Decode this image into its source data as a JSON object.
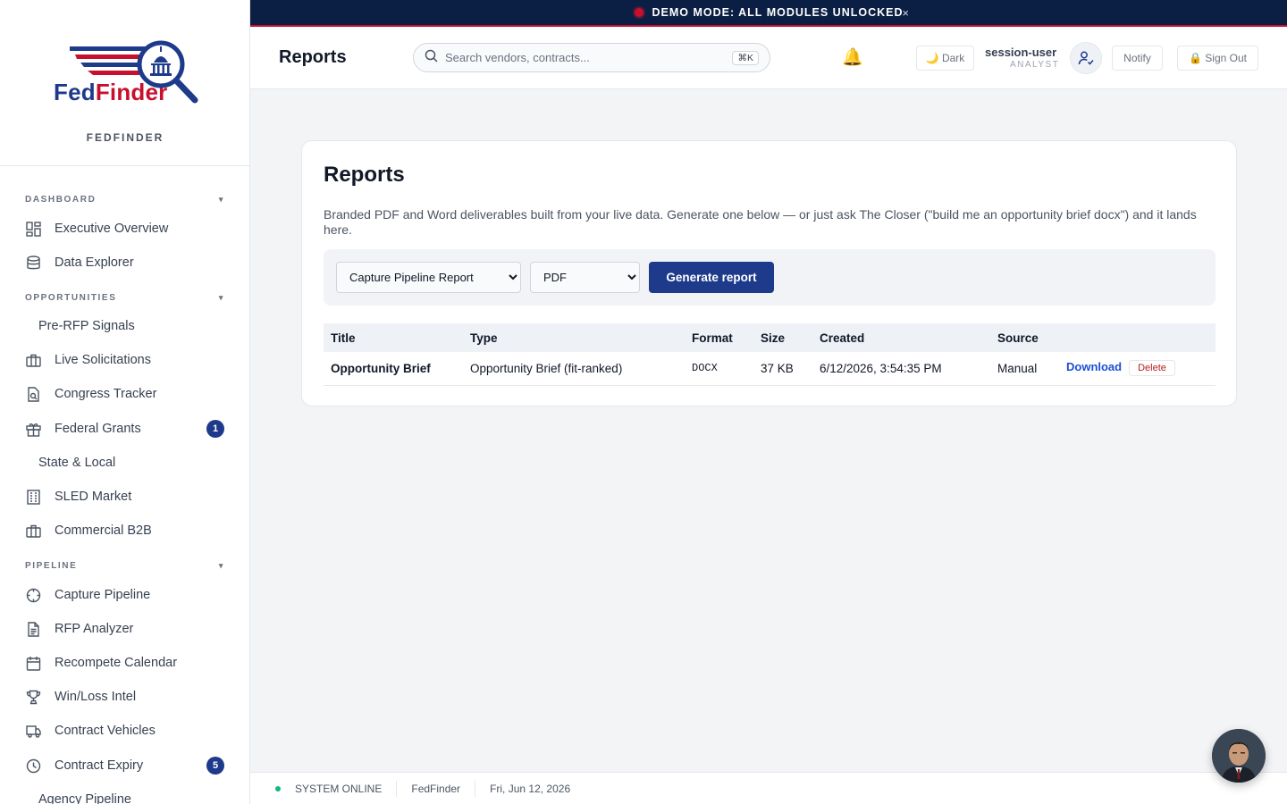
{
  "banner": {
    "text": "DEMO MODE: ALL MODULES UNLOCKED",
    "close": "×"
  },
  "brand": {
    "logo_fed": "Fed",
    "logo_finder": "Finder",
    "name": "FEDFINDER"
  },
  "sidebar": {
    "sections": [
      {
        "label": "DASHBOARD",
        "caret": "▾"
      },
      {
        "label": "OPPORTUNITIES",
        "caret": "▾"
      },
      {
        "label": "PIPELINE",
        "caret": "▾"
      }
    ],
    "items": [
      {
        "label": "Executive Overview",
        "icon": "dashboard-grid-icon"
      },
      {
        "label": "Data Explorer",
        "icon": "database-icon"
      },
      {
        "label": "Pre-RFP Signals"
      },
      {
        "label": "Live Solicitations",
        "icon": "briefcase-icon"
      },
      {
        "label": "Congress Tracker",
        "icon": "document-search-icon"
      },
      {
        "label": "Federal Grants",
        "icon": "gift-icon",
        "badge": "1"
      },
      {
        "label": "State & Local"
      },
      {
        "label": "SLED Market",
        "icon": "building-icon"
      },
      {
        "label": "Commercial B2B",
        "icon": "briefcase-icon"
      },
      {
        "label": "Capture Pipeline",
        "icon": "crosshair-icon"
      },
      {
        "label": "RFP Analyzer",
        "icon": "file-text-icon"
      },
      {
        "label": "Recompete Calendar",
        "icon": "calendar-icon"
      },
      {
        "label": "Win/Loss Intel",
        "icon": "trophy-icon"
      },
      {
        "label": "Contract Vehicles",
        "icon": "truck-icon"
      },
      {
        "label": "Contract Expiry",
        "icon": "clock-icon",
        "badge": "5"
      },
      {
        "label": "Agency Pipeline"
      }
    ]
  },
  "header": {
    "title": "Reports",
    "search_placeholder": "Search vendors, contracts...",
    "search_shortcut": "⌘K",
    "theme_button": "🌙 Dark",
    "user_name": "session-user",
    "user_role": "ANALYST",
    "notify_button": "Notify",
    "signout_button": "🔒 Sign Out"
  },
  "main": {
    "title": "Reports",
    "description": "Branded PDF and Word deliverables built from your live data. Generate one below — or just ask The Closer (\"build me an opportunity brief docx\") and it lands here.",
    "report_type_selected": "Capture Pipeline Report",
    "format_selected": "PDF",
    "generate_button": "Generate report",
    "table": {
      "columns": [
        "Title",
        "Type",
        "Format",
        "Size",
        "Created",
        "Source",
        ""
      ],
      "rows": [
        {
          "title": "Opportunity Brief",
          "type": "Opportunity Brief (fit-ranked)",
          "format": "DOCX",
          "size": "37 KB",
          "created": "6/12/2026, 3:54:35 PM",
          "source": "Manual",
          "download": "Download",
          "delete": "Delete"
        }
      ]
    }
  },
  "footer": {
    "status": "SYSTEM ONLINE",
    "app": "FedFinder",
    "date": "Fri, Jun 12, 2026"
  },
  "colors": {
    "navy": "#1e3a8a",
    "red": "#c8102e",
    "banner": "#0b1f44",
    "online": "#10b981"
  }
}
